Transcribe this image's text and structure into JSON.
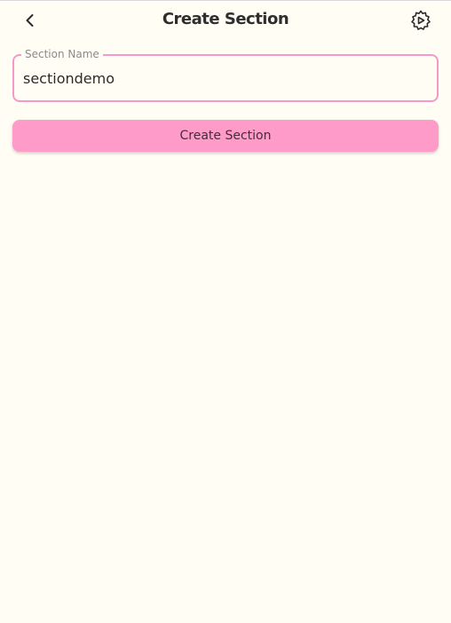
{
  "header": {
    "title": "Create Section",
    "back_icon": "chevron-left-icon",
    "settings_icon": "gear-icon"
  },
  "form": {
    "section_name_label": "Section Name",
    "section_name_value": "sectiondemo"
  },
  "actions": {
    "create_label": "Create Section"
  },
  "colors": {
    "background": "#fffdf4",
    "accent": "#ff9bc9",
    "field_border": "#f49ac9"
  }
}
